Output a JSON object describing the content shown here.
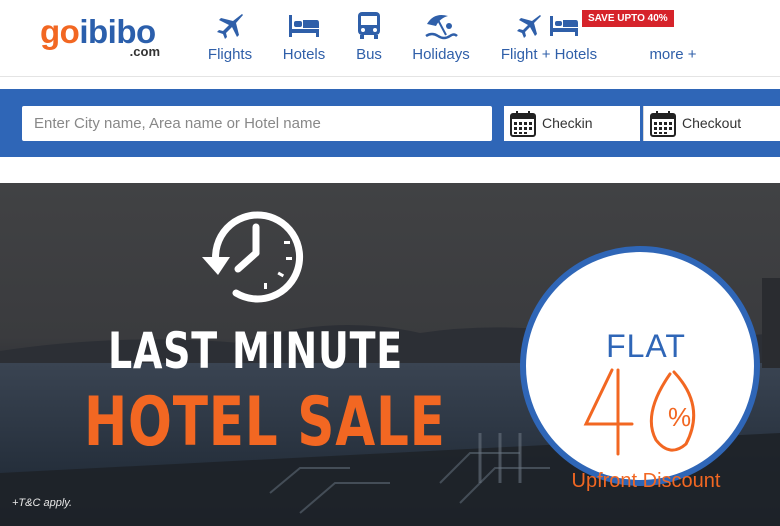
{
  "brand": {
    "logo_go": "go",
    "logo_ibibo": "ibibo",
    "logo_com": ".com",
    "colors": {
      "orange": "#f26722",
      "blue": "#2f66b7",
      "sale_red": "#d6232a"
    }
  },
  "nav": {
    "items": [
      {
        "label": "Flights",
        "icon": "airplane-icon"
      },
      {
        "label": "Hotels",
        "icon": "bed-icon"
      },
      {
        "label": "Bus",
        "icon": "bus-icon"
      },
      {
        "label": "Holidays",
        "icon": "beach-umbrella-icon"
      },
      {
        "label": "Flight + Hotels",
        "icon": "airplane-bed-icon"
      },
      {
        "label": "more +",
        "icon": ""
      }
    ],
    "promo_badge": "SAVE UPTO 40%"
  },
  "search": {
    "placeholder": "Enter City name, Area name or Hotel name",
    "value": "",
    "checkin_label": "Checkin",
    "checkout_label": "Checkout",
    "calendar_icon": "calendar-icon"
  },
  "banner": {
    "headline_line1": "LAST MINUTE",
    "headline_line2": "HOTEL SALE",
    "clock_icon": "clock-rewind-icon",
    "offer": {
      "flat": "FLAT",
      "number": "40",
      "percent": "%",
      "caption": "Upfront Discount"
    },
    "footnote": "+T&C apply."
  }
}
